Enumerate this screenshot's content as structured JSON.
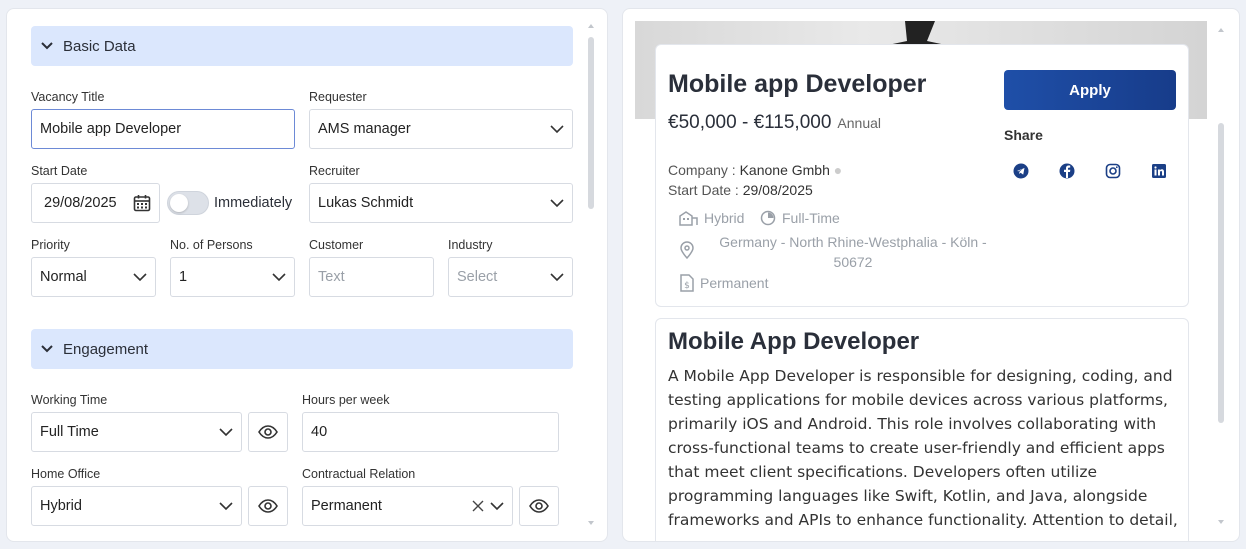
{
  "form": {
    "basic_section": "Basic Data",
    "engagement_section": "Engagement",
    "vacancy_title_label": "Vacancy Title",
    "vacancy_title_value_a": "Mobile ",
    "vacancy_title_value_b": "app",
    "vacancy_title_value_c": " Developer",
    "requester_label": "Requester",
    "requester_value": "AMS manager",
    "start_date_label": "Start Date",
    "start_date_value": "29/08/2025",
    "immediately_label": "Immediately",
    "recruiter_label": "Recruiter",
    "recruiter_value": "Lukas Schmidt",
    "priority_label": "Priority",
    "priority_value": "Normal",
    "persons_label": "No. of Persons",
    "persons_value": "1",
    "customer_label": "Customer",
    "customer_placeholder": "Text",
    "industry_label": "Industry",
    "industry_placeholder": "Select",
    "working_time_label": "Working Time",
    "working_time_value": "Full Time",
    "hours_label": "Hours per week",
    "hours_value": "40",
    "home_office_label": "Home Office",
    "home_office_value": "Hybrid",
    "contractual_label": "Contractual Relation",
    "contractual_value": "Permanent"
  },
  "preview": {
    "title": "Mobile app Developer",
    "salary": "€50,000 - €115,000",
    "salary_unit": "Annual",
    "company_label": "Company :",
    "company_value": "Kanone Gmbh",
    "start_label": "Start Date :",
    "start_value": "29/08/2025",
    "work_mode": "Hybrid",
    "work_time": "Full-Time",
    "location_line1": "Germany - North Rhine-Westphalia - Köln -",
    "location_line2": "50672",
    "contract": "Permanent",
    "apply_label": "Apply",
    "share_label": "Share",
    "desc_title": "Mobile App Developer",
    "desc_line1": "A Mobile App Developer is responsible for designing, coding, and",
    "desc_line2": "testing applications for mobile devices across various platforms,",
    "desc_line3": "primarily iOS and Android. This role involves collaborating with",
    "desc_line4": "cross-functional teams to create user-friendly and efficient apps",
    "desc_line5": "that meet client specifications. Developers often utilize",
    "desc_line6": "programming languages like Swift, Kotlin, and Java, alongside",
    "desc_line7": "frameworks and APIs to enhance functionality. Attention to detail,"
  },
  "icons": {
    "share": [
      "telegram-icon",
      "facebook-icon",
      "instagram-icon",
      "linkedin-icon"
    ]
  },
  "colors": {
    "accent": "#1f4fa8",
    "section_bg": "#dbe7fd"
  }
}
